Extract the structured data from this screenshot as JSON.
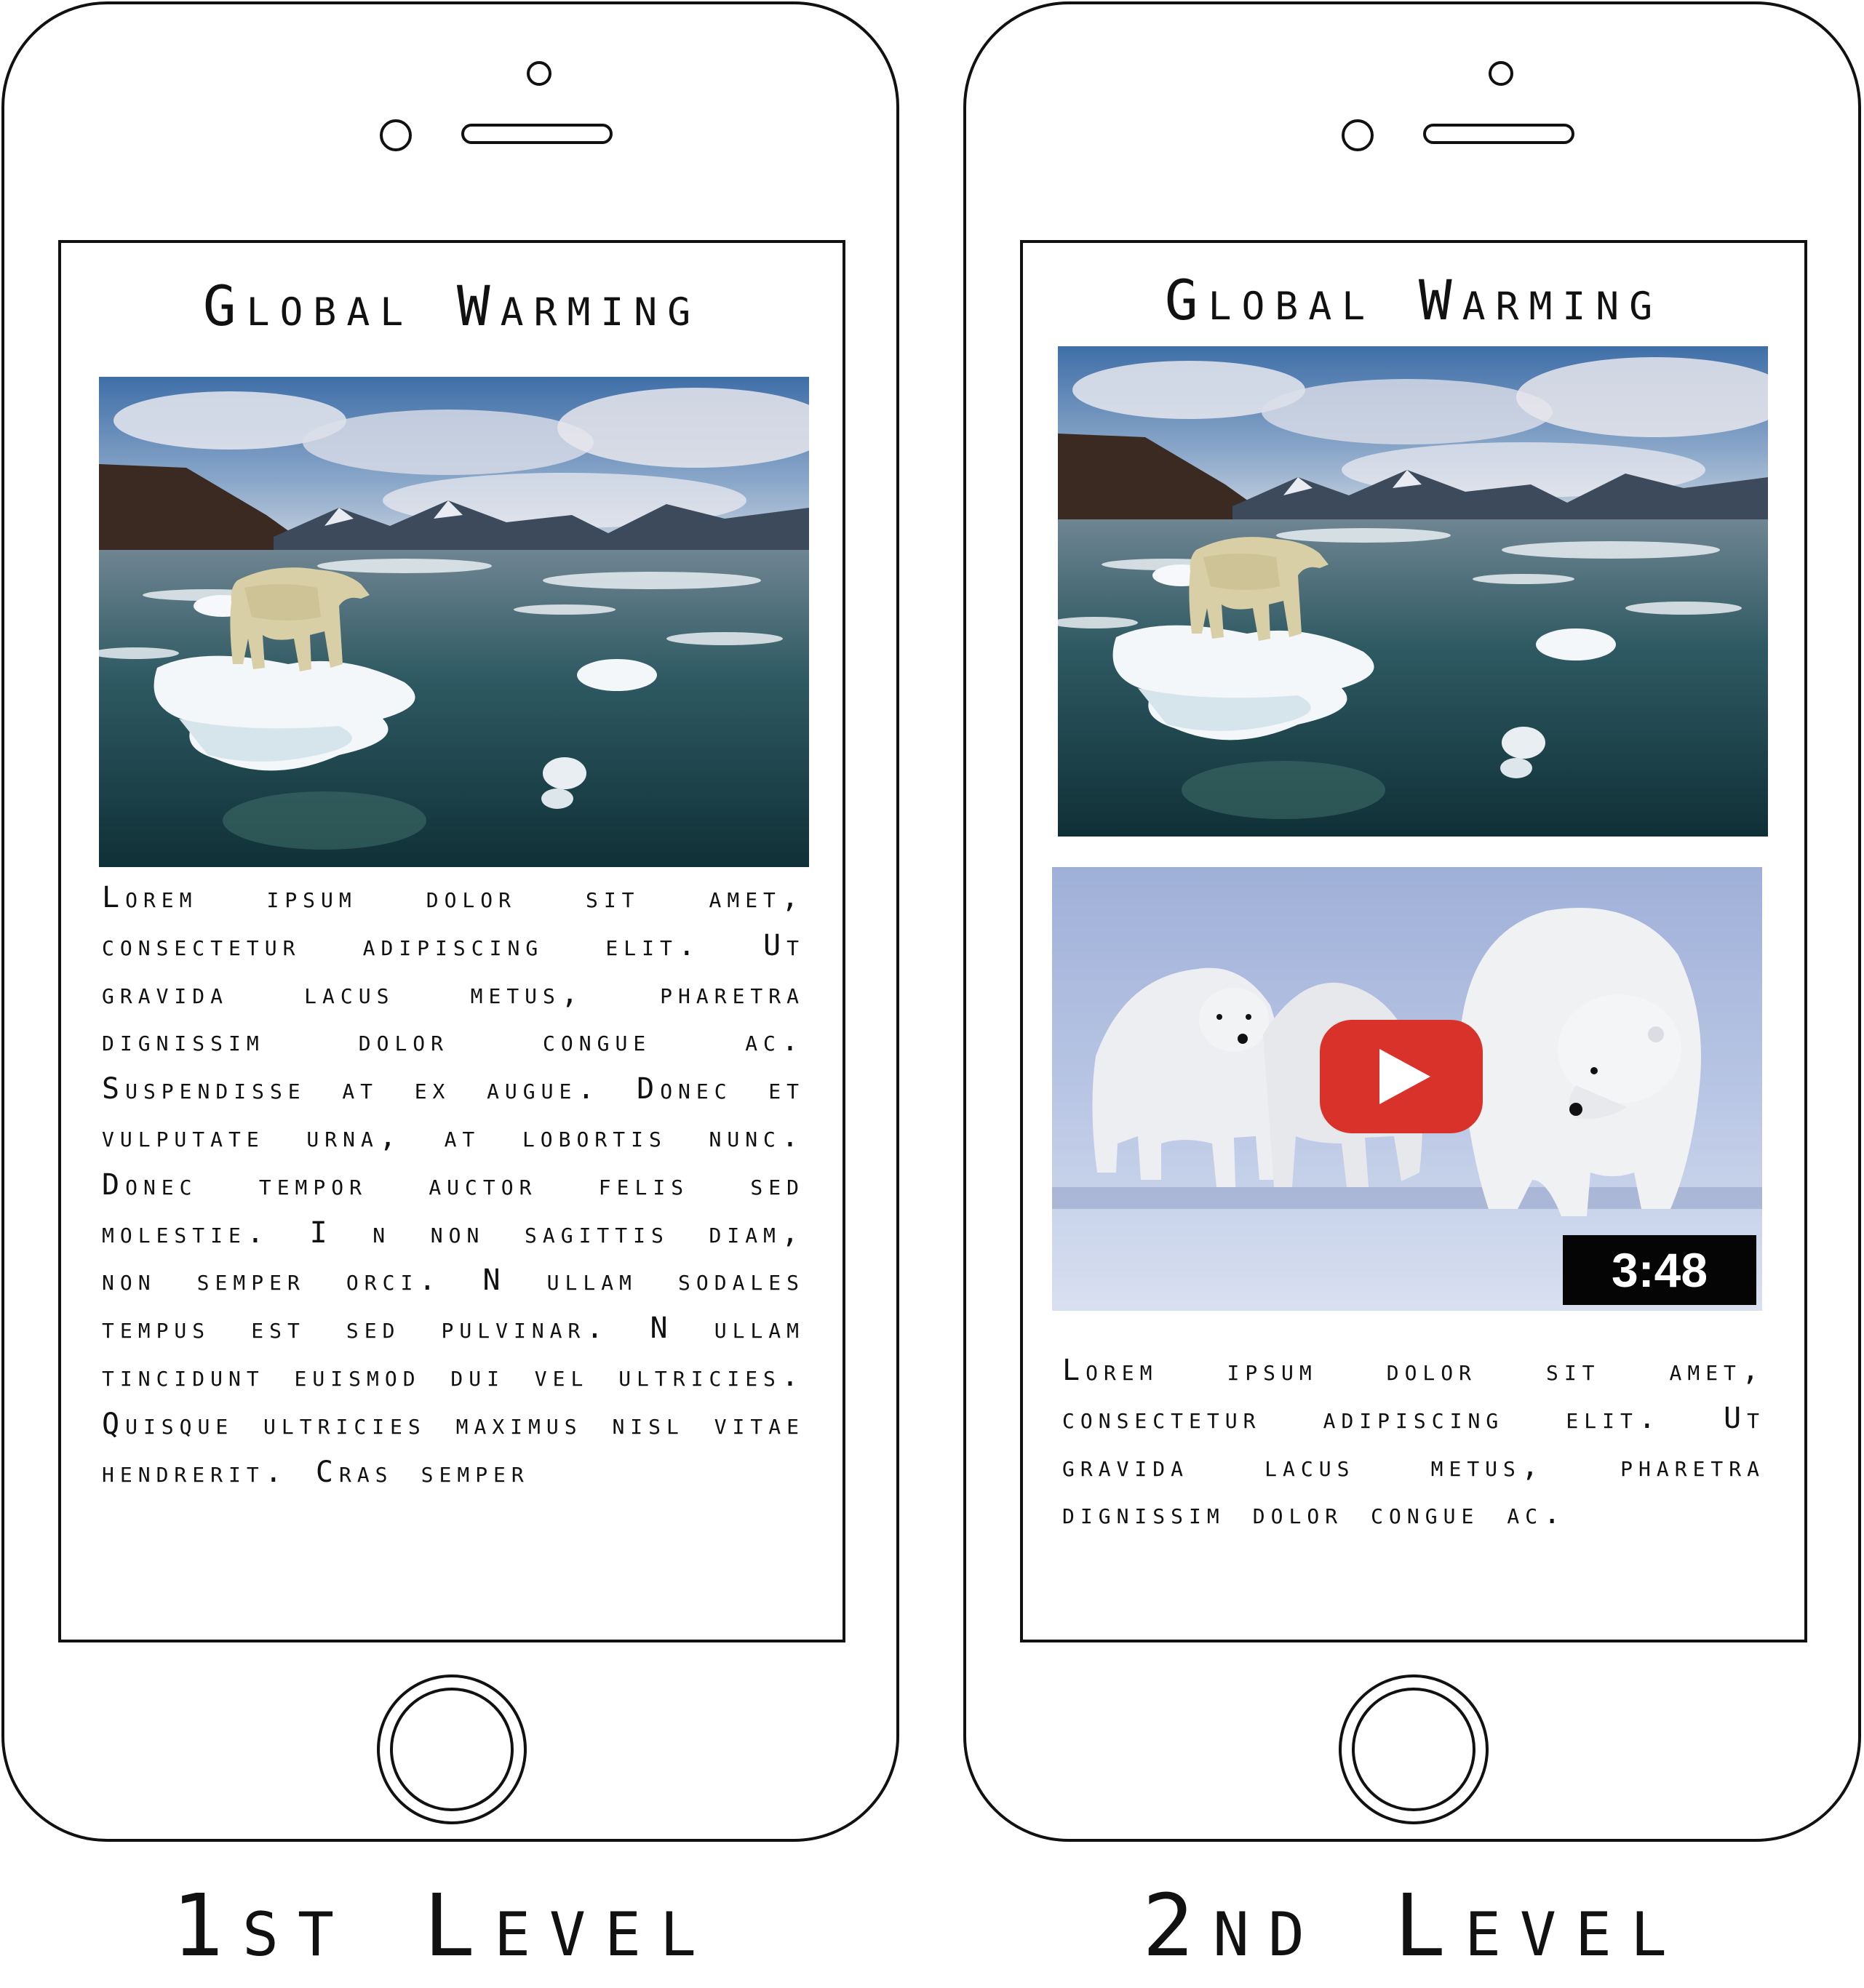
{
  "phones": [
    {
      "screen": {
        "title": "Global Warming",
        "image": "polar-bear-on-ice-floe-photo",
        "body": "Lorem ipsum dolor sit amet, consectetur adipiscing elit. Ut gravida lacus metus, pharetra dignissim dolor congue ac. Suspendisse at ex augue. Donec et vulputate urna, at lobortis nunc. Donec tempor auctor felis sed molestie. I n non sagittis diam, non semper orci. N ullam sodales tempus est sed pulvinar. N ullam tincidunt euismod dui vel ultricies. Quisque ultricies maximus nisl vitae hendrerit. Cras semper"
      },
      "caption": "1st Level"
    },
    {
      "screen": {
        "title": "Global Warming",
        "image": "polar-bear-on-ice-floe-photo",
        "video": {
          "thumbnail": "polar-bear-family-on-ice-photo",
          "play_icon": "play-icon",
          "duration": "3:48",
          "play_button_color": "#d8322b"
        },
        "body": "Lorem ipsum dolor sit amet, consectetur adipiscing elit. Ut gravida lacus metus, pharetra dignissim dolor congue ac."
      },
      "caption": "2nd Level"
    }
  ]
}
